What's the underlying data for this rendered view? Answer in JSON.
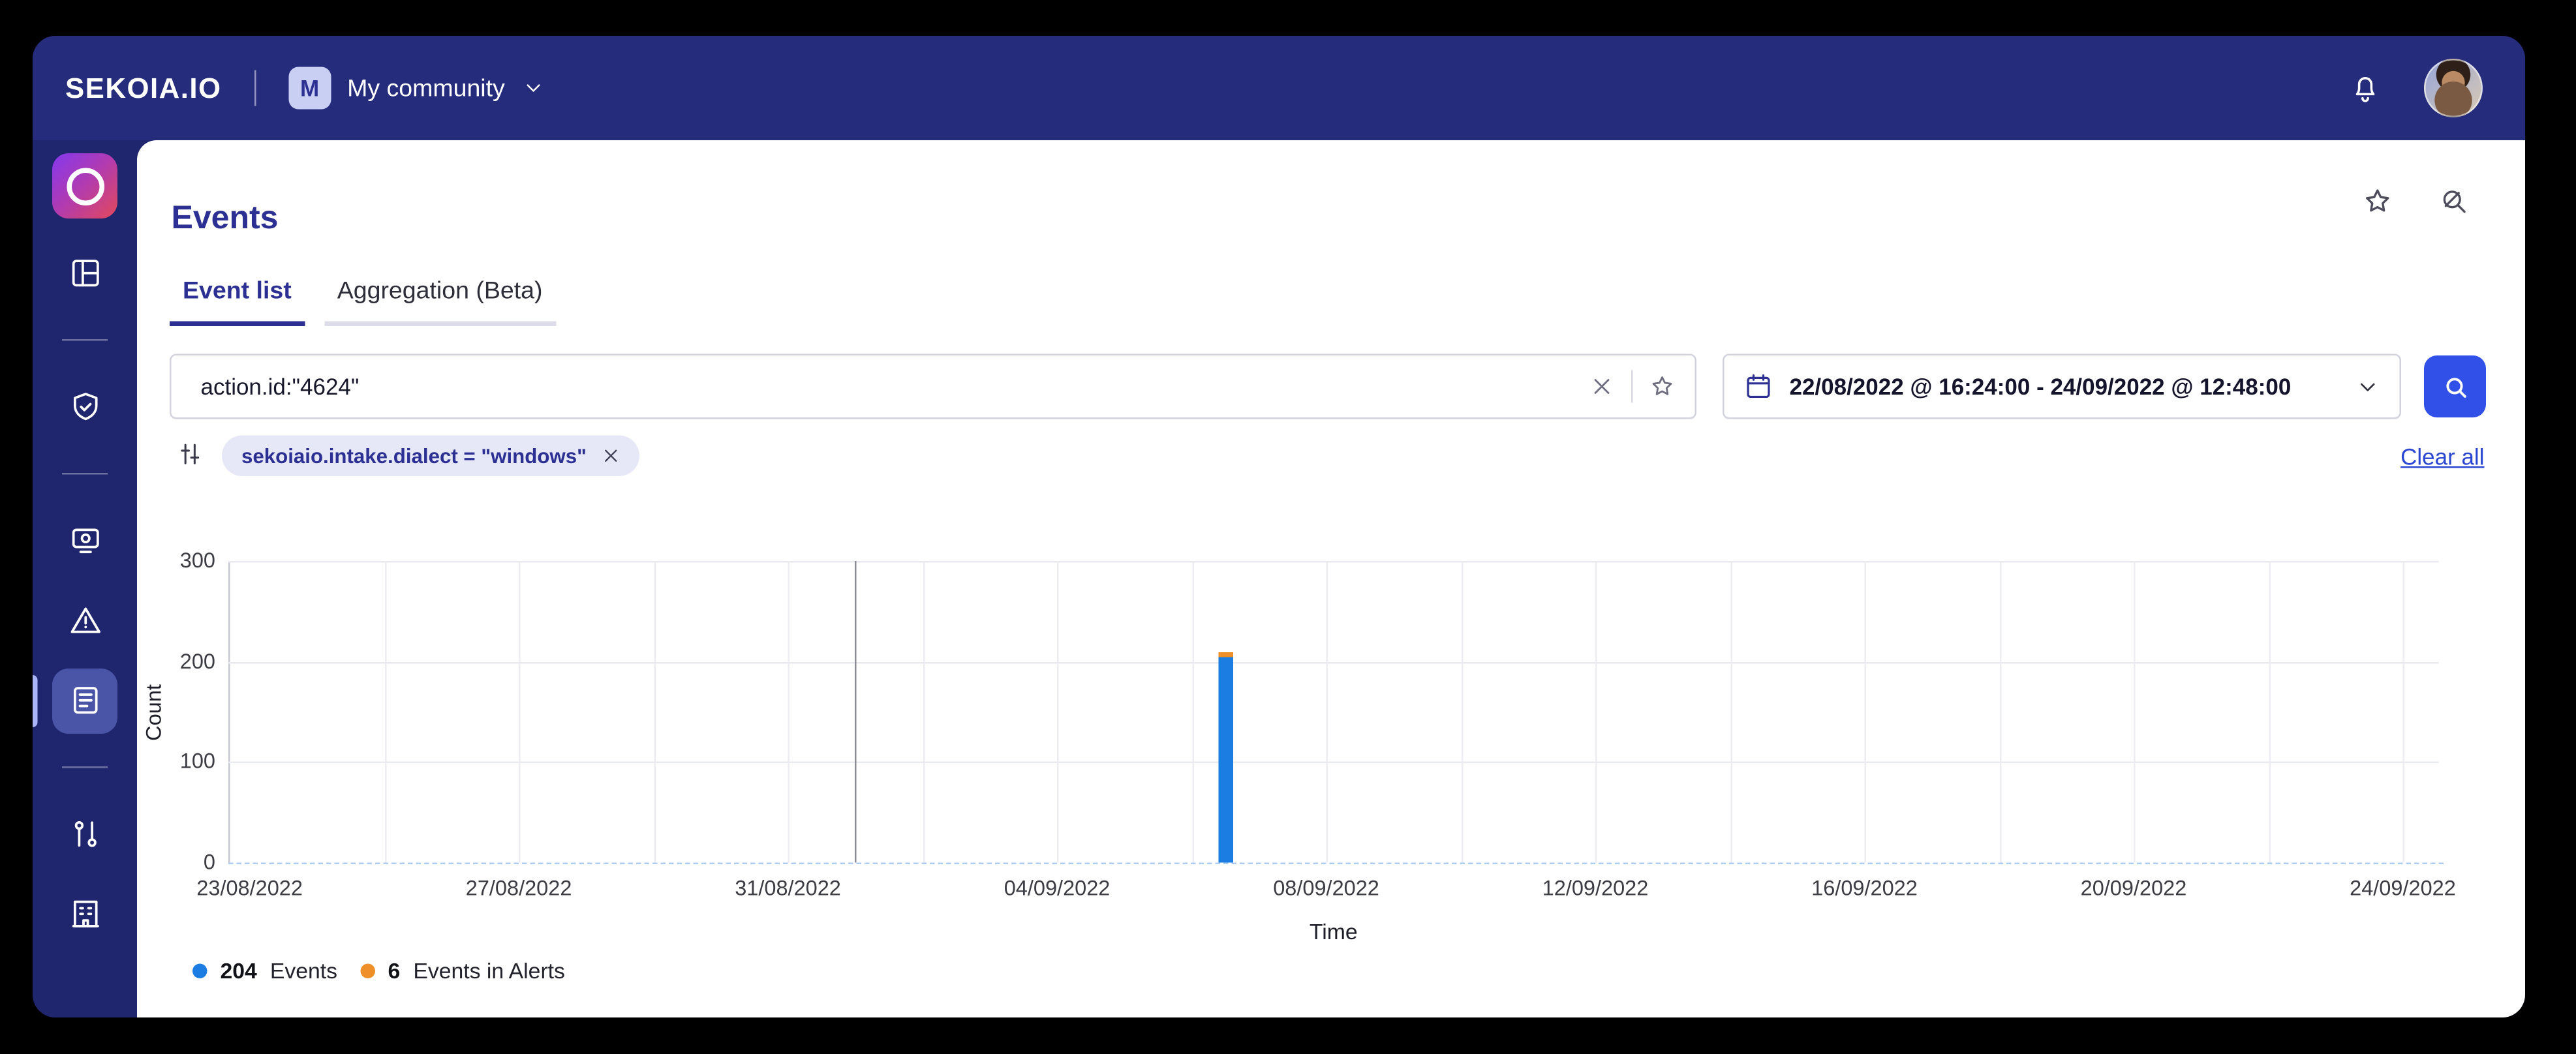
{
  "navbar": {
    "brand": "SEKOIA.IO",
    "community": {
      "badge": "M",
      "name": "My community"
    }
  },
  "sidebar": {
    "items": [
      {
        "type": "item",
        "icon": "layout-dashboard"
      },
      {
        "type": "divider"
      },
      {
        "type": "item",
        "icon": "shield-check"
      },
      {
        "type": "divider"
      },
      {
        "type": "item",
        "icon": "monitor-camera"
      },
      {
        "type": "item",
        "icon": "alert-triangle"
      },
      {
        "type": "item",
        "icon": "event-list",
        "active": true
      },
      {
        "type": "divider"
      },
      {
        "type": "item",
        "icon": "compare"
      },
      {
        "type": "item",
        "icon": "building"
      }
    ]
  },
  "page": {
    "title": "Events",
    "tabs": [
      {
        "label": "Event list"
      },
      {
        "label": "Aggregation (Beta)"
      }
    ],
    "search": {
      "value": "action.id:\"4624\""
    },
    "date_range": {
      "value": "22/08/2022 @ 16:24:00 - 24/09/2022 @ 12:48:00"
    },
    "filters": {
      "chip": "sekoiaio.intake.dialect = \"windows\"",
      "clear_all": "Clear all"
    }
  },
  "chart_data": {
    "type": "bar",
    "title": "",
    "xlabel": "Time",
    "ylabel": "Count",
    "ylim": [
      0,
      300
    ],
    "yticks": [
      0,
      100,
      200,
      300
    ],
    "x_domain": [
      "22/08/2022 16:24",
      "24/09/2022 12:48"
    ],
    "xticks": [
      "23/08/2022",
      "27/08/2022",
      "31/08/2022",
      "04/09/2022",
      "08/09/2022",
      "12/09/2022",
      "16/09/2022",
      "20/09/2022",
      "24/09/2022"
    ],
    "minor_gridline_days": 2,
    "month_divider": "01/09/2022",
    "bars": [
      {
        "x": "06/09/2022 12:00",
        "events": 204,
        "events_in_alerts": 6
      }
    ],
    "series": [
      {
        "name": "Events",
        "color": "#1b7de2"
      },
      {
        "name": "Events in Alerts",
        "color": "#ef8f27"
      }
    ],
    "legend": [
      {
        "value": "204",
        "label": "Events",
        "color": "#1b7de2"
      },
      {
        "value": "6",
        "label": "Events in Alerts",
        "color": "#ef8f27"
      }
    ]
  },
  "colors": {
    "navbar_bg": "#262c7c",
    "sidebar_bg": "#20266e",
    "accent": "#2c3092",
    "primary_button": "#3050e8",
    "chip_bg": "#e6e8f8",
    "link": "#2946d2"
  }
}
